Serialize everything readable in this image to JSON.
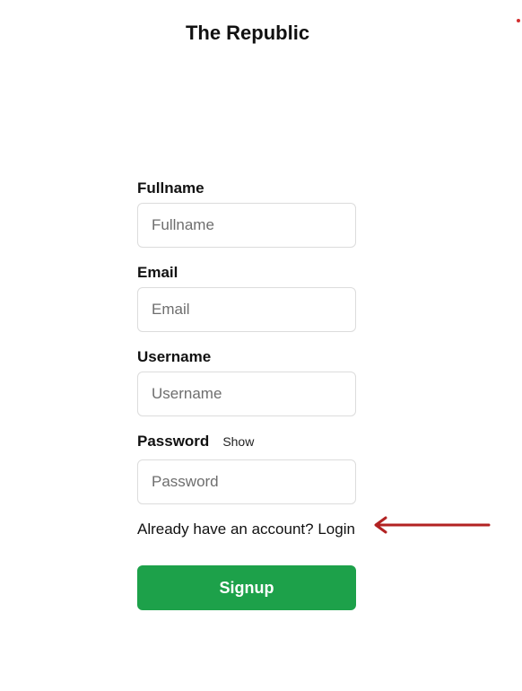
{
  "header": {
    "title": "The Republic"
  },
  "form": {
    "fullname": {
      "label": "Fullname",
      "placeholder": "Fullname",
      "value": ""
    },
    "email": {
      "label": "Email",
      "placeholder": "Email",
      "value": ""
    },
    "username": {
      "label": "Username",
      "placeholder": "Username",
      "value": ""
    },
    "password": {
      "label": "Password",
      "show_label": "Show",
      "placeholder": "Password",
      "value": ""
    },
    "login_prompt": "Already have an account?",
    "login_link": "Login",
    "submit_label": "Signup"
  },
  "colors": {
    "primary_button": "#1da14a",
    "annotation_arrow": "#b22222",
    "corner_dot": "#d32f2f"
  },
  "icons": {
    "annotation": "left-arrow-icon"
  }
}
